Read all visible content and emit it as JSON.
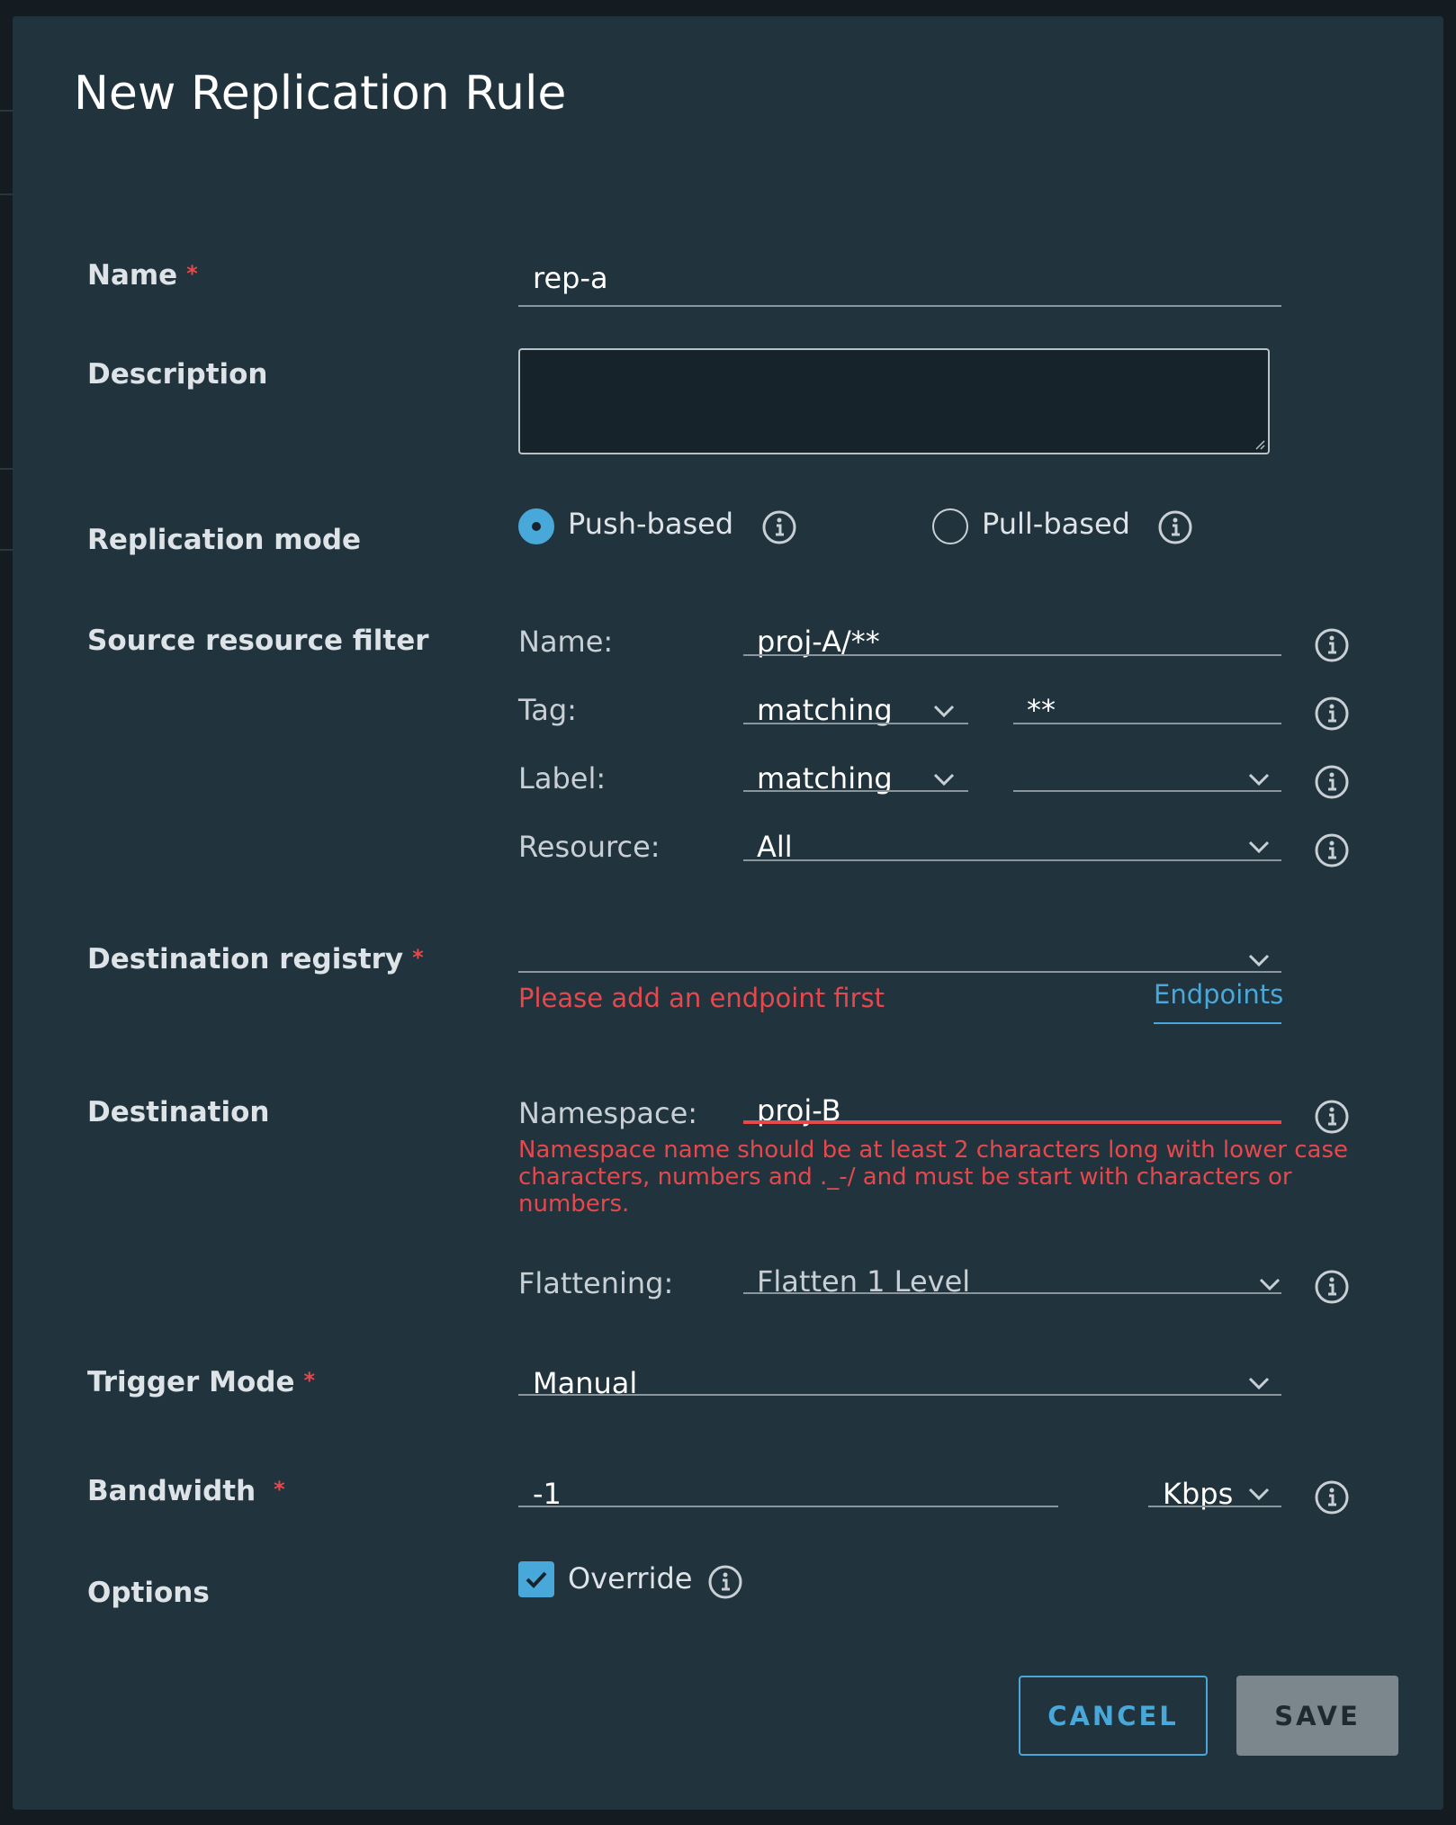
{
  "dialog": {
    "title": "New Replication Rule"
  },
  "labels": {
    "name": "Name",
    "description": "Description",
    "replication_mode": "Replication mode",
    "source_filter": "Source resource filter",
    "destination_registry": "Destination registry",
    "destination": "Destination",
    "trigger_mode": "Trigger Mode",
    "bandwidth": "Bandwidth",
    "options": "Options",
    "required_mark": "*"
  },
  "name_field": {
    "value": "rep-a"
  },
  "description_field": {
    "value": ""
  },
  "replication_mode": {
    "push_label": "Push-based",
    "pull_label": "Pull-based",
    "selected": "push"
  },
  "source_filter": {
    "name_label": "Name:",
    "name_value": "proj-A/**",
    "tag_label": "Tag:",
    "tag_match": "matching",
    "tag_value": "**",
    "label_label": "Label:",
    "label_match": "matching",
    "label_value": "",
    "resource_label": "Resource:",
    "resource_value": "All"
  },
  "destination_registry": {
    "value": "",
    "error": "Please add an endpoint first",
    "endpoints_link": "Endpoints"
  },
  "destination": {
    "namespace_label": "Namespace:",
    "namespace_value": "proj-B",
    "namespace_error": "Namespace name should be at least 2 characters long with lower case characters, numbers and ._-/ and must be start with characters or numbers.",
    "flattening_label": "Flattening:",
    "flattening_value": "Flatten 1 Level"
  },
  "trigger": {
    "value": "Manual"
  },
  "bandwidth": {
    "value": "-1",
    "unit": "Kbps"
  },
  "options": {
    "override_label": "Override",
    "override_checked": true
  },
  "buttons": {
    "cancel": "CANCEL",
    "save": "SAVE"
  },
  "colors": {
    "dialog_bg": "#21333c",
    "accent": "#48a8da",
    "error": "#e5484d",
    "save_disabled": "#7b878d"
  },
  "icons": {
    "info": "info-circle-icon",
    "chevron": "chevron-down-icon",
    "check": "checkmark-icon"
  }
}
